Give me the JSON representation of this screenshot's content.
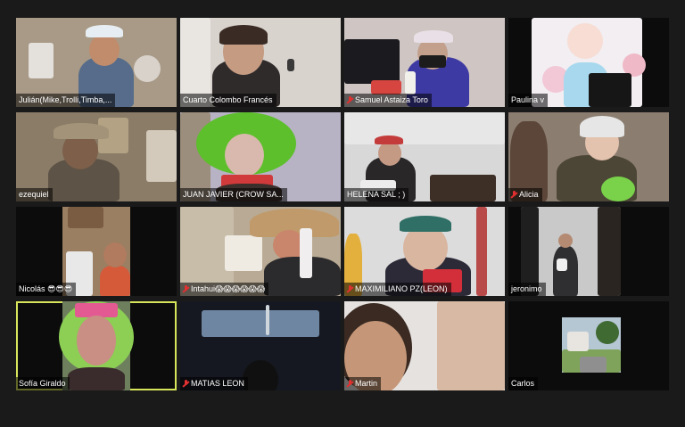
{
  "meeting": {
    "active_speaker_color": "#d7e55a",
    "muted_icon_color": "#e0302f",
    "participants": [
      {
        "name": "Julián(Mike,Trolli,Timba,...",
        "muted": false,
        "active": false,
        "bg": "#a89a86"
      },
      {
        "name": "Cuarto Colombo Francés",
        "muted": false,
        "active": false,
        "bg": "#d9d3cd"
      },
      {
        "name": "Samuel Astaiza Toro",
        "muted": true,
        "active": false,
        "bg": "#cfc6c3"
      },
      {
        "name": "Paulina v",
        "muted": false,
        "active": false,
        "bg": "#f2eef2"
      },
      {
        "name": "ezequiel",
        "muted": false,
        "active": false,
        "bg": "#8a7c67"
      },
      {
        "name": "JUAN JAVIER (CROW SA...",
        "muted": false,
        "active": false,
        "bg": "#b7b2c4"
      },
      {
        "name": "HELENA SAL ; )",
        "muted": false,
        "active": false,
        "bg": "#d8d8d8"
      },
      {
        "name": "Alicia",
        "muted": true,
        "active": false,
        "bg": "#8b7d70"
      },
      {
        "name": "Nicolás 😎😎😎",
        "muted": false,
        "active": false,
        "bg": "#9a7f63"
      },
      {
        "name": "Intahui😱😱😱😱😱😱",
        "muted": true,
        "active": false,
        "bg": "#b8aa94"
      },
      {
        "name": "MAXIMILIANO PZ(LEON)",
        "muted": true,
        "active": false,
        "bg": "#dcdcdc"
      },
      {
        "name": "jeronimo",
        "muted": false,
        "active": false,
        "bg": "#c9c9c9"
      },
      {
        "name": "Sofía Giraldo",
        "muted": false,
        "active": true,
        "bg": "#6e7f5d"
      },
      {
        "name": "MATIAS LEON",
        "muted": true,
        "active": false,
        "bg": "#1f2a3a"
      },
      {
        "name": "Martin",
        "muted": true,
        "active": false,
        "bg": "#e6e2df"
      },
      {
        "name": "Carlos",
        "muted": false,
        "active": false,
        "bg": "#b6c7d4"
      }
    ]
  }
}
